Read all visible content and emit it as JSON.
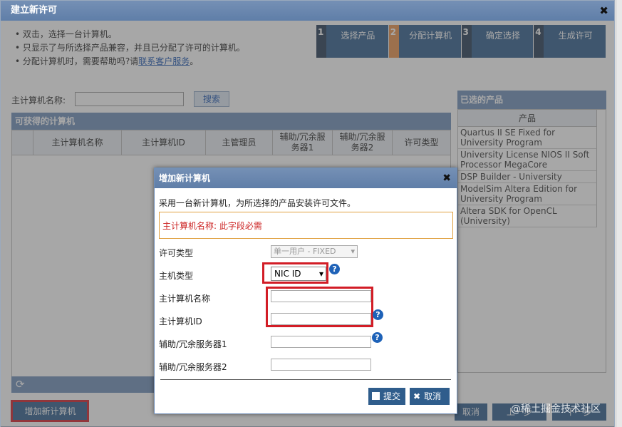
{
  "window": {
    "title": "建立新许可"
  },
  "instructions": {
    "line1": "• 双击，选择一台计算机。",
    "line2": "• 只显示了与所选择产品兼容，并且已分配了许可的计算机。",
    "line3_prefix": "• 分配计算机时，需要帮助吗?请",
    "line3_link": "联系客户服务",
    "line3_suffix": "。"
  },
  "steps": [
    {
      "num": "1",
      "label": "选择产品"
    },
    {
      "num": "2",
      "label": "分配计算机"
    },
    {
      "num": "3",
      "label": "确定选择"
    },
    {
      "num": "4",
      "label": "生成许可"
    }
  ],
  "search": {
    "label": "主计算机名称:",
    "button": "搜索"
  },
  "available": {
    "title": "可获得的计算机",
    "columns": [
      "主计算机名称",
      "主计算机ID",
      "主管理员",
      "辅助/冗余服务器1",
      "辅助/冗余服务器2",
      "许可类型"
    ]
  },
  "add_button": "增加新计算机",
  "selected": {
    "title": "已选的产品",
    "column": "产品",
    "items": [
      "Quartus II SE Fixed for University Program",
      "University License NIOS II Soft Processor MegaCore",
      "DSP Builder - University",
      "ModelSim Altera Edition for University Program",
      "Altera SDK for OpenCL (University)"
    ]
  },
  "footer": {
    "cancel": "取消",
    "prev": "上一步",
    "next": "下一步"
  },
  "watermark": "@稀土掘金技术社区",
  "dialog": {
    "title": "增加新计算机",
    "description": "采用一台新计算机，为所选择的产品安装许可文件。",
    "error": "主计算机名称: 此字段必需",
    "fields": {
      "license_type": {
        "label": "许可类型",
        "value": "单一用户 - FIXED"
      },
      "host_type": {
        "label": "主机类型",
        "value": "NIC ID"
      },
      "host_name": {
        "label": "主计算机名称",
        "value": ""
      },
      "host_id": {
        "label": "主计算机ID",
        "value": ""
      },
      "server1": {
        "label": "辅助/冗余服务器1",
        "value": ""
      },
      "server2": {
        "label": "辅助/冗余服务器2",
        "value": ""
      }
    },
    "submit": "提交",
    "cancel": "取消"
  }
}
